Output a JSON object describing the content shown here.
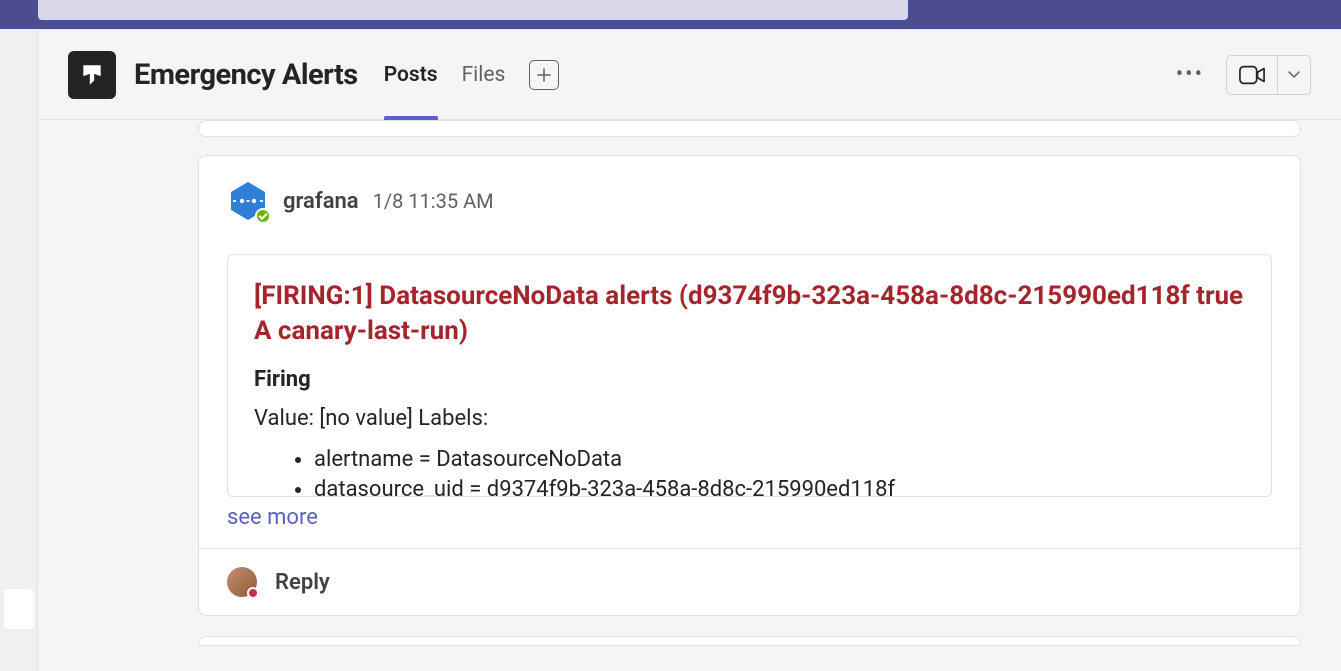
{
  "header": {
    "channel_title": "Emergency Alerts",
    "tabs": {
      "posts": "Posts",
      "files": "Files"
    }
  },
  "message": {
    "author": "grafana",
    "timestamp": "1/8 11:35 AM",
    "alert": {
      "title": "[FIRING:1] DatasourceNoData alerts (d9374f9b-323a-458a-8d8c-215990ed118f true A canary-last-run)",
      "status": "Firing",
      "value_line": "Value: [no value] Labels:",
      "labels": [
        "alertname = DatasourceNoData",
        "datasource_uid = d9374f9b-323a-458a-8d8c-215990ed118f"
      ]
    },
    "see_more": "see more",
    "reply_label": "Reply"
  }
}
